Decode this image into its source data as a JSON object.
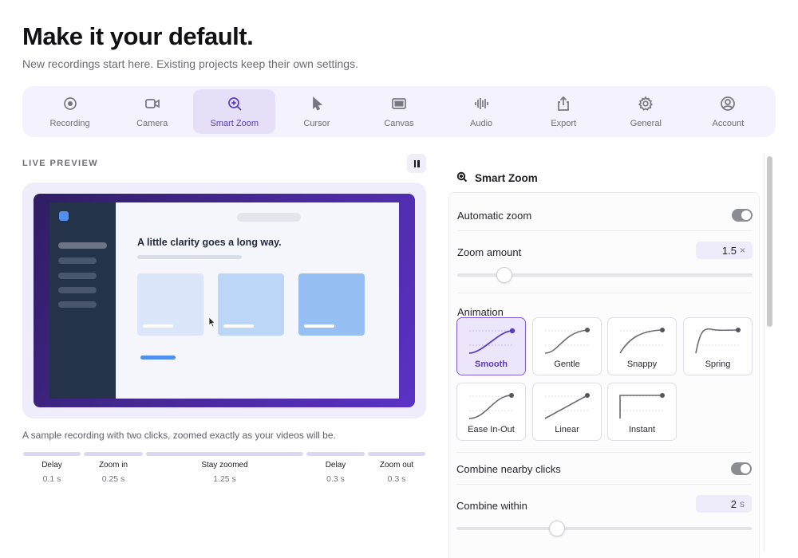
{
  "header": {
    "title": "Make it your default.",
    "subtitle": "New recordings start here. Existing projects keep their own settings."
  },
  "tabs": [
    {
      "label": "Recording",
      "icon": "record-icon",
      "active": false
    },
    {
      "label": "Camera",
      "icon": "camera-icon",
      "active": false
    },
    {
      "label": "Smart Zoom",
      "icon": "zoom-in-icon",
      "active": true
    },
    {
      "label": "Cursor",
      "icon": "cursor-icon",
      "active": false
    },
    {
      "label": "Canvas",
      "icon": "canvas-icon",
      "active": false
    },
    {
      "label": "Audio",
      "icon": "waveform-icon",
      "active": false
    },
    {
      "label": "Export",
      "icon": "share-icon",
      "active": false
    },
    {
      "label": "General",
      "icon": "gear-icon",
      "active": false
    },
    {
      "label": "Account",
      "icon": "user-icon",
      "active": false
    }
  ],
  "preview": {
    "label": "LIVE PREVIEW",
    "mock_heading": "A little clarity goes a long way.",
    "caption": "A sample recording with two clicks, zoomed exactly as your videos will be.",
    "timeline": [
      {
        "name": "Delay",
        "value": "0.1 s"
      },
      {
        "name": "Zoom in",
        "value": "0.25 s"
      },
      {
        "name": "Stay zoomed",
        "value": "1.25 s"
      },
      {
        "name": "Delay",
        "value": "0.3 s"
      },
      {
        "name": "Zoom out",
        "value": "0.3 s"
      }
    ]
  },
  "panel": {
    "title": "Smart Zoom",
    "automatic_zoom": {
      "label": "Automatic zoom",
      "enabled": true
    },
    "zoom_amount": {
      "label": "Zoom amount",
      "value": "1.5",
      "unit": "×",
      "slider_fraction": 0.16
    },
    "animation": {
      "label": "Animation",
      "selected": "Smooth",
      "options": [
        "Smooth",
        "Gentle",
        "Snappy",
        "Spring",
        "Ease In-Out",
        "Linear",
        "Instant"
      ]
    },
    "combine_clicks": {
      "label": "Combine nearby clicks",
      "enabled": true
    },
    "combine_within": {
      "label": "Combine within",
      "value": "2",
      "unit": "s",
      "slider_fraction": 0.34
    }
  },
  "colors": {
    "accent": "#5a3bc4",
    "tab_active_bg": "#e5e0f7",
    "preview_gradient_start": "#2f1d63",
    "preview_gradient_end": "#5a32c4"
  }
}
